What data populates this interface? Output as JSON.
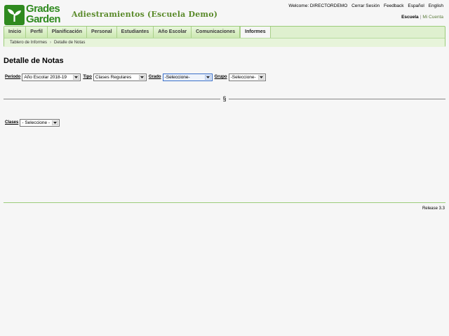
{
  "header": {
    "logo_line1": "Grades",
    "logo_line2": "Garden",
    "app_title": "Adiestramientos (Escuela Demo)",
    "links": {
      "welcome": "Welcome: DIRECTORDEMO",
      "logout": "Cerrar Sesión",
      "feedback": "Feedback",
      "spanish": "Español",
      "english": "English"
    },
    "school_tab": "Escuela",
    "separator": "|",
    "account_tab": "Mi Cuenta"
  },
  "nav": {
    "tabs": [
      "Inicio",
      "Perfil",
      "Planificación",
      "Personal",
      "Estudiantes",
      "Año Escolar",
      "Comunicaciones",
      "Informes"
    ],
    "active_index": 7
  },
  "breadcrumb": {
    "items": [
      "Tablero de Informes",
      "Detalle de Notas"
    ],
    "arrow": "›"
  },
  "page": {
    "title": "Detalle de Notas"
  },
  "filters": {
    "periodo": {
      "label": "Periodo",
      "value": "Año Escolar 2018-19"
    },
    "tipo": {
      "label": "Tipo",
      "value": "Clases Regulares"
    },
    "grado": {
      "label": "Grado",
      "value": "-Seleccione-"
    },
    "grupo": {
      "label": "Grupo",
      "value": "-Seleccione-"
    }
  },
  "divider_symbol": "§",
  "clases": {
    "label": "Clases",
    "value": "- Seleccione -"
  },
  "footer": {
    "release": "Release 3.3"
  },
  "colors": {
    "brand_green": "#2f8a1f",
    "nav_bg": "#dff0cf",
    "title_green": "#5a8a2a"
  }
}
